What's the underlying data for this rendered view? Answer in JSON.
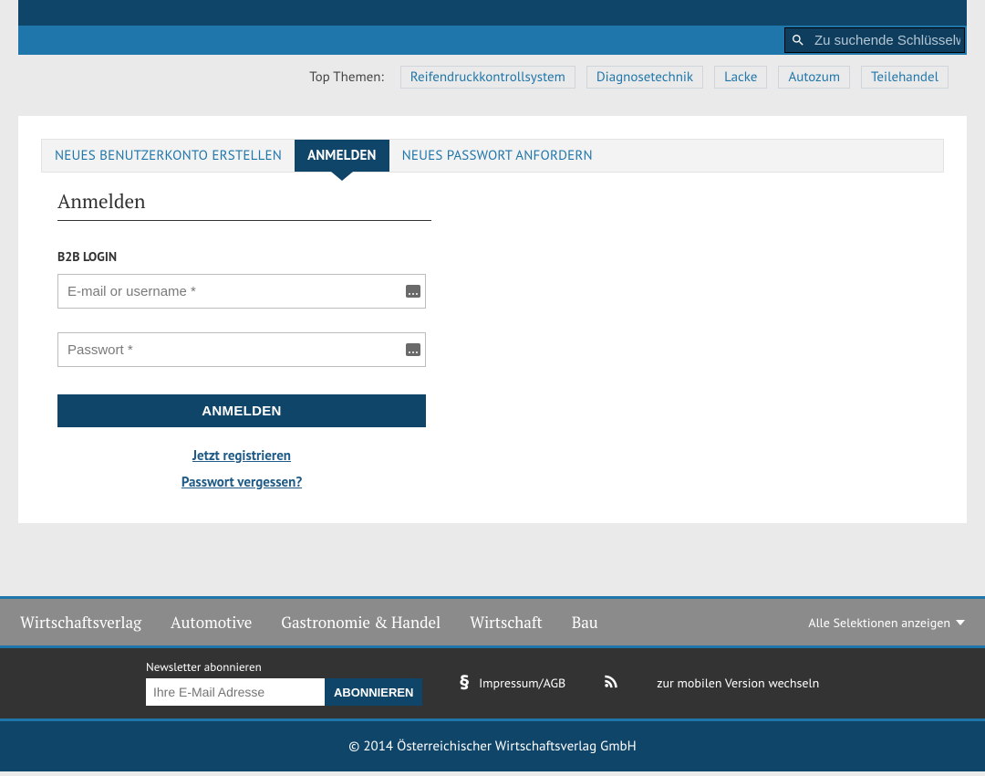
{
  "search": {
    "placeholder": "Zu suchende Schlüsselw"
  },
  "topthemen": {
    "label": "Top Themen:",
    "items": [
      "Reifendruckkontrollsystem",
      "Diagnosetechnik",
      "Lacke",
      "Autozum",
      "Teilehandel"
    ]
  },
  "tabs": {
    "new_account": "NEUES BENUTZERKONTO ERSTELLEN",
    "login": "ANMELDEN",
    "new_password": "NEUES PASSWORT ANFORDERN"
  },
  "login": {
    "title": "Anmelden",
    "b2b_label": "B2B LOGIN",
    "email_placeholder": "E-mail or username *",
    "password_placeholder": "Passwort *",
    "button": "ANMELDEN",
    "register": "Jetzt registrieren",
    "forgot": "Passwort vergessen?"
  },
  "footer": {
    "categories": [
      "Wirtschaftsverlag",
      "Automotive",
      "Gastronomie & Handel",
      "Wirtschaft",
      "Bau"
    ],
    "show_all": "Alle Selektionen anzeigen",
    "newsletter_label": "Newsletter abonnieren",
    "newsletter_placeholder": "Ihre E-Mail Adresse",
    "newsletter_button": "ABONNIEREN",
    "impressum": "Impressum/AGB",
    "mobile": "zur mobilen Version wechseln",
    "copyright": "© 2014 Österreichischer Wirtschaftsverlag GmbH"
  }
}
